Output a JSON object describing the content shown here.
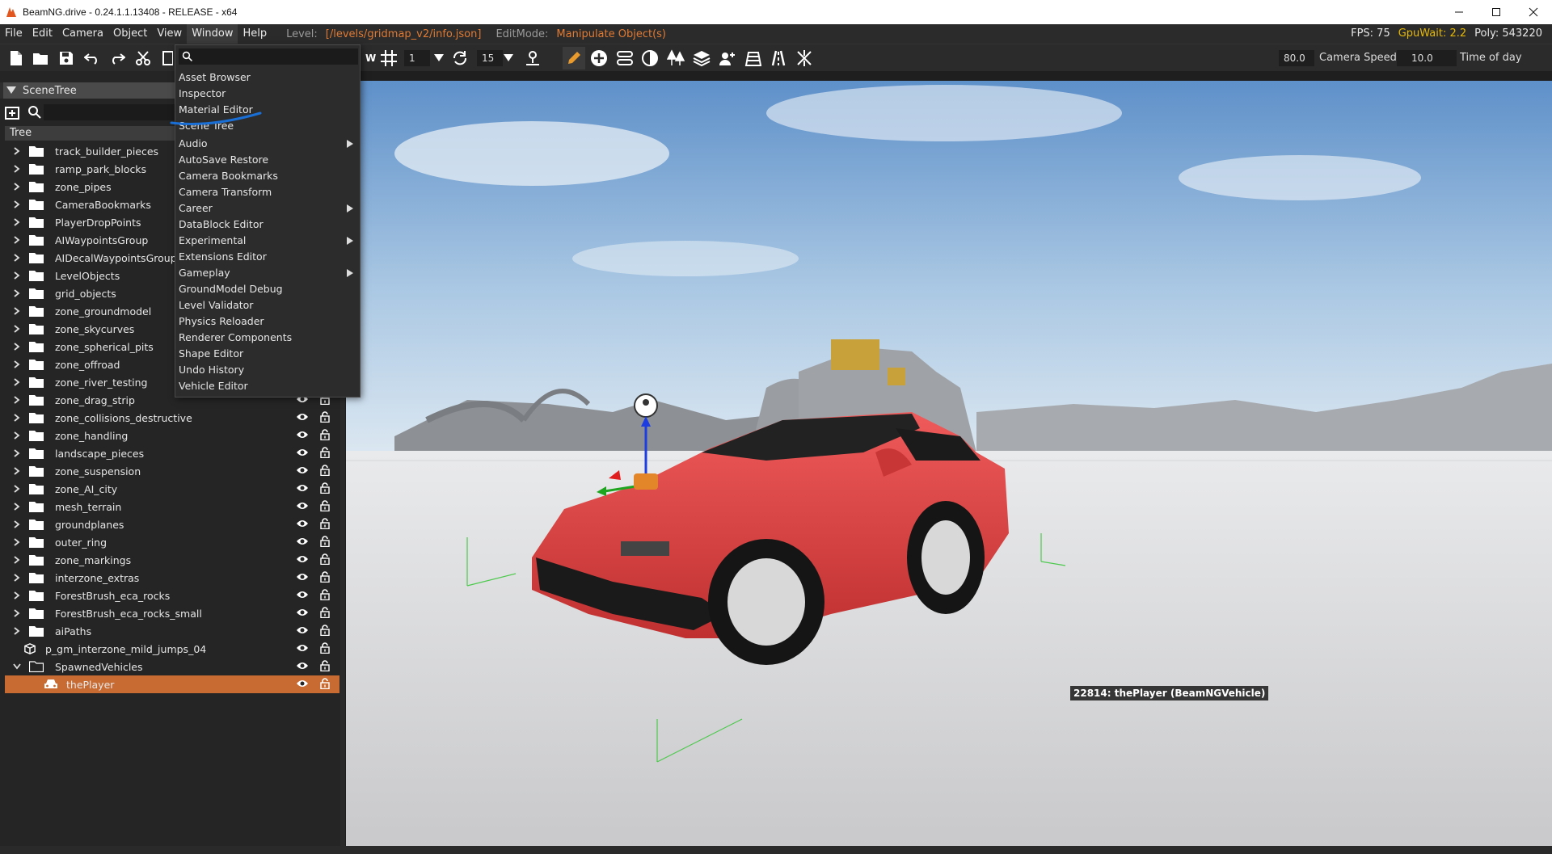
{
  "window": {
    "title": "BeamNG.drive - 0.24.1.1.13408 - RELEASE - x64"
  },
  "menubar": {
    "menus": [
      "File",
      "Edit",
      "Camera",
      "Object",
      "View",
      "Window",
      "Help"
    ],
    "active_menu": "Window",
    "level_label": "Level:",
    "level_value": "[/levels/gridmap_v2/info.json]",
    "editmode_label": "EditMode:",
    "editmode_value": "Manipulate Object(s)",
    "fps": "FPS: 75",
    "gpuwait": "GpuWait: 2.2",
    "poly": "Poly: 543220"
  },
  "toolbar": {
    "grid_value": "1",
    "rotate_value": "15",
    "fov_value": "80.0",
    "camera_speed_label": "Camera Speed",
    "camera_speed_value": "10.0",
    "time_of_day_label": "Time of day"
  },
  "scenetree": {
    "tab_label": "SceneTree",
    "header": "Tree",
    "items": [
      {
        "name": "track_builder_pieces",
        "kind": "folder"
      },
      {
        "name": "ramp_park_blocks",
        "kind": "folder"
      },
      {
        "name": "zone_pipes",
        "kind": "folder"
      },
      {
        "name": "CameraBookmarks",
        "kind": "folder"
      },
      {
        "name": "PlayerDropPoints",
        "kind": "folder"
      },
      {
        "name": "AIWaypointsGroup",
        "kind": "folder"
      },
      {
        "name": "AIDecalWaypointsGroup",
        "kind": "folder"
      },
      {
        "name": "LevelObjects",
        "kind": "folder"
      },
      {
        "name": "grid_objects",
        "kind": "folder"
      },
      {
        "name": "zone_groundmodel",
        "kind": "folder"
      },
      {
        "name": "zone_skycurves",
        "kind": "folder"
      },
      {
        "name": "zone_spherical_pits",
        "kind": "folder"
      },
      {
        "name": "zone_offroad",
        "kind": "folder"
      },
      {
        "name": "zone_river_testing",
        "kind": "folder"
      },
      {
        "name": "zone_drag_strip",
        "kind": "folder"
      },
      {
        "name": "zone_collisions_destructive",
        "kind": "folder"
      },
      {
        "name": "zone_handling",
        "kind": "folder"
      },
      {
        "name": "landscape_pieces",
        "kind": "folder"
      },
      {
        "name": "zone_suspension",
        "kind": "folder"
      },
      {
        "name": "zone_AI_city",
        "kind": "folder"
      },
      {
        "name": "mesh_terrain",
        "kind": "folder"
      },
      {
        "name": "groundplanes",
        "kind": "folder"
      },
      {
        "name": "outer_ring",
        "kind": "folder"
      },
      {
        "name": "zone_markings",
        "kind": "folder"
      },
      {
        "name": "interzone_extras",
        "kind": "folder"
      },
      {
        "name": "ForestBrush_eca_rocks",
        "kind": "folder"
      },
      {
        "name": "ForestBrush_eca_rocks_small",
        "kind": "folder"
      },
      {
        "name": "aiPaths",
        "kind": "folder"
      },
      {
        "name": "p_gm_interzone_mild_jumps_04",
        "kind": "prefab"
      },
      {
        "name": "SpawnedVehicles",
        "kind": "open-folder"
      },
      {
        "name": "thePlayer",
        "kind": "vehicle"
      }
    ]
  },
  "window_menu": {
    "items": [
      {
        "label": "Asset Browser",
        "submenu": false
      },
      {
        "label": "Inspector",
        "submenu": false
      },
      {
        "label": "Material Editor",
        "submenu": false
      },
      {
        "label": "Scene Tree",
        "submenu": false
      },
      {
        "label": "Audio",
        "submenu": true
      },
      {
        "label": "AutoSave Restore",
        "submenu": false
      },
      {
        "label": "Camera Bookmarks",
        "submenu": false
      },
      {
        "label": "Camera Transform",
        "submenu": false
      },
      {
        "label": "Career",
        "submenu": true
      },
      {
        "label": "DataBlock Editor",
        "submenu": false
      },
      {
        "label": "Experimental",
        "submenu": true
      },
      {
        "label": "Extensions Editor",
        "submenu": false
      },
      {
        "label": "Gameplay",
        "submenu": true
      },
      {
        "label": "GroundModel Debug",
        "submenu": false
      },
      {
        "label": "Level Validator",
        "submenu": false
      },
      {
        "label": "Physics Reloader",
        "submenu": false
      },
      {
        "label": "Renderer Components",
        "submenu": false
      },
      {
        "label": "Shape Editor",
        "submenu": false
      },
      {
        "label": "Undo History",
        "submenu": false
      },
      {
        "label": "Vehicle Editor",
        "submenu": false
      }
    ]
  },
  "viewport": {
    "selection_label": "22814: thePlayer (BeamNGVehicle)"
  },
  "colors": {
    "accent": "#c86b33",
    "highlight_orange": "#e07a33",
    "warning": "#e6b800",
    "annotation": "#1a6fd6"
  }
}
